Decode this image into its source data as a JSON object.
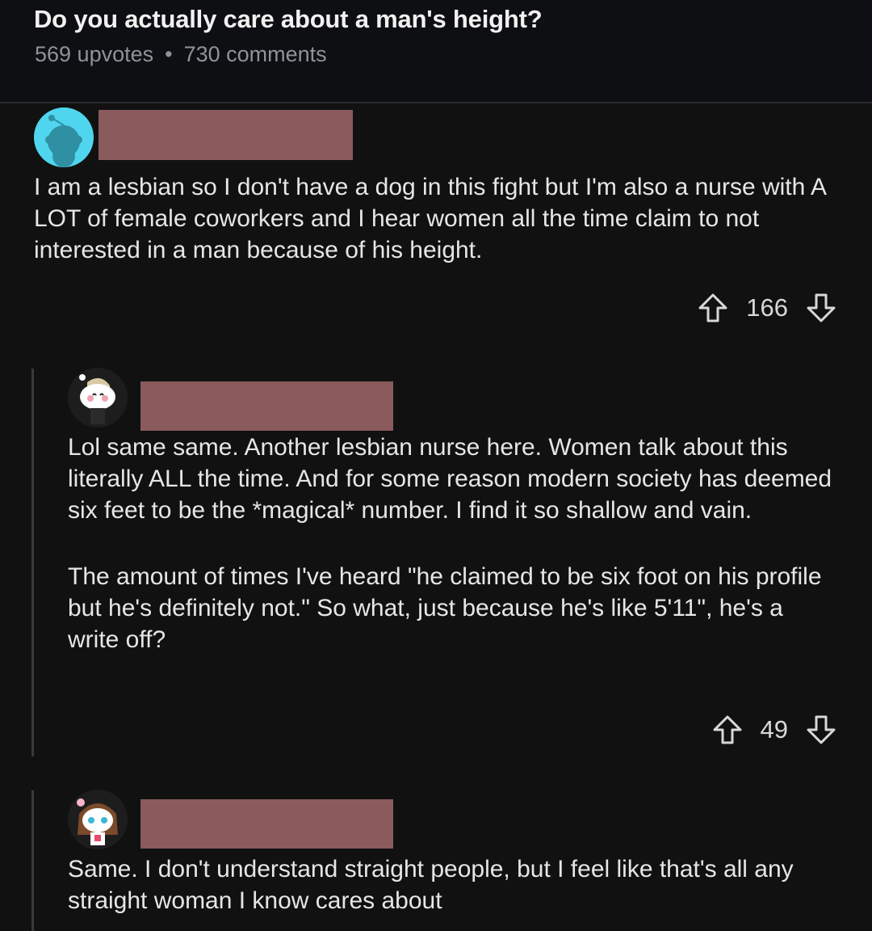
{
  "post": {
    "title": "Do you actually care about a man's height?",
    "upvotes": "569 upvotes",
    "separator": "•",
    "comments": "730 comments"
  },
  "comments": [
    {
      "avatar_icon": "snoo-avatar-icon",
      "text": [
        "I am a lesbian so I don't have a dog in this fight but I'm also a nurse with A LOT of female coworkers and I hear women all the time claim to not interested in a man because of his height."
      ],
      "score": "166"
    },
    {
      "avatar_icon": "snoo-avatar-icon",
      "text": [
        "Lol same same. Another lesbian nurse here. Women talk about this literally ALL the time. And for some reason modern society has deemed six feet to be the *magical* number. I find it so shallow and vain.",
        "The amount of times I've heard \"he claimed to be six foot on his profile but he's definitely not.\" So what, just because he's like 5'11\", he's a write off?"
      ],
      "score": "49"
    },
    {
      "avatar_icon": "snoo-avatar-icon",
      "text": [
        "Same. I don't understand straight people, but I feel like that's all any straight woman I know cares about"
      ]
    }
  ],
  "colors": {
    "background": "#111111",
    "redaction": "#8a5a5c",
    "avatar_teal": "#4fd6ee"
  }
}
